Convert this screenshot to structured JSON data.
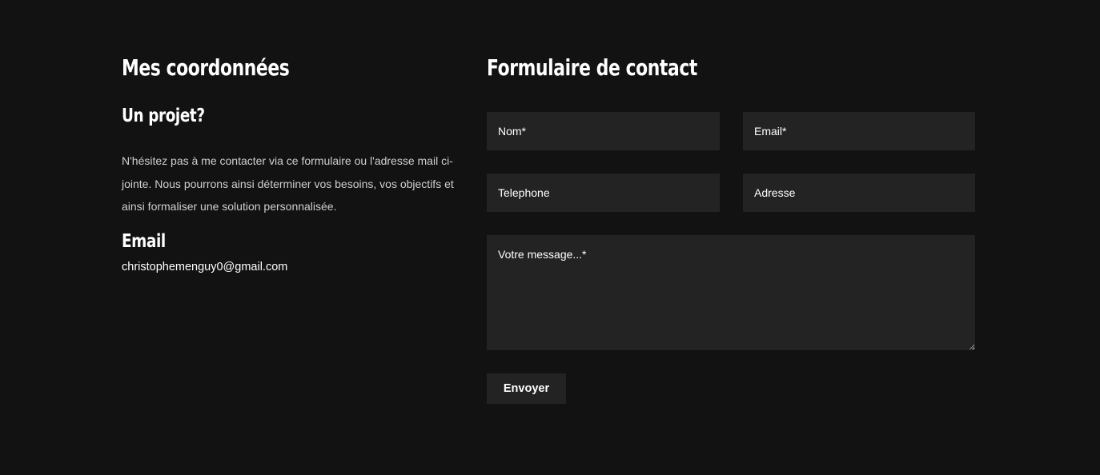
{
  "info": {
    "title": "Mes coordonnées",
    "project_title": "Un projet?",
    "intro": "N'hésitez pas à me contacter via ce formulaire ou l'adresse mail ci-jointe. Nous pourrons ainsi déterminer vos besoins, vos objectifs et ainsi formaliser une solution personnalisée.",
    "email_title": "Email",
    "email_value": "christophemenguy0@gmail.com"
  },
  "form": {
    "title": "Formulaire de contact",
    "fields": {
      "nom": {
        "placeholder": "Nom*",
        "value": ""
      },
      "email": {
        "placeholder": "Email*",
        "value": ""
      },
      "telephone": {
        "placeholder": "Telephone",
        "value": ""
      },
      "adresse": {
        "placeholder": "Adresse",
        "value": ""
      },
      "message": {
        "placeholder": "Votre message...*",
        "value": ""
      }
    },
    "submit_label": "Envoyer"
  },
  "colors": {
    "background": "#121212",
    "field_background": "#232323",
    "text": "#ffffff",
    "muted_text": "#cfcfcf"
  }
}
